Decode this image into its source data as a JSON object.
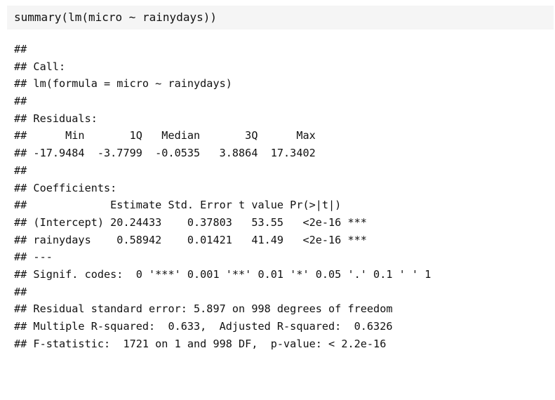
{
  "code": {
    "input": "summary(lm(micro ~ rainydays))"
  },
  "output": {
    "lines": [
      "##",
      "## Call:",
      "## lm(formula = micro ~ rainydays)",
      "##",
      "## Residuals:",
      "##      Min       1Q   Median       3Q      Max",
      "## -17.9484  -3.7799  -0.0535   3.8864  17.3402",
      "##",
      "## Coefficients:",
      "##             Estimate Std. Error t value Pr(>|t|)",
      "## (Intercept) 20.24433    0.37803   53.55   <2e-16 ***",
      "## rainydays    0.58942    0.01421   41.49   <2e-16 ***",
      "## ---",
      "## Signif. codes:  0 '***' 0.001 '**' 0.01 '*' 0.05 '.' 0.1 ' ' 1",
      "##",
      "## Residual standard error: 5.897 on 998 degrees of freedom",
      "## Multiple R-squared:  0.633,  Adjusted R-squared:  0.6326",
      "## F-statistic:  1721 on 1 and 998 DF,  p-value: < 2.2e-16"
    ]
  }
}
